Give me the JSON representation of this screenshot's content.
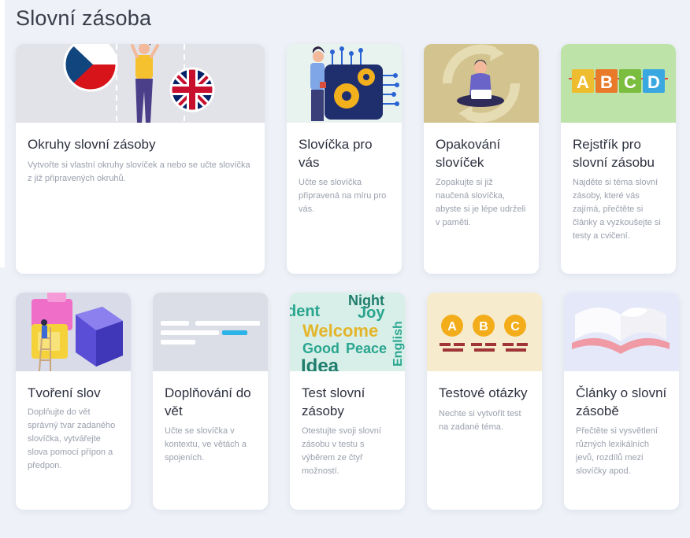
{
  "page": {
    "title": "Slovní zásoba"
  },
  "cards": [
    {
      "title": "Okruhy slovní zásoby",
      "description": "Vytvořte si vlastní okruhy slovíček a nebo se učte slovíčka z již připravených okruhů.",
      "image": "czech-english-flags-illustration"
    },
    {
      "title": "Slovíčka pro vás",
      "description": "Učte se slovíčka připravená na míru pro vás.",
      "image": "person-with-gears-illustration"
    },
    {
      "title": "Opakování slovíček",
      "description": "Zopakujte si již naučená slovíčka, abyste si je lépe udrželi v paměti.",
      "image": "person-with-laptop-illustration"
    },
    {
      "title": "Rejstřík pro slovní zásobu",
      "description": "Najděte si téma slovní zásoby, které vás zajímá, přečtěte si články a vyzkoušejte si testy a cvičení.",
      "image": "abcd-blocks-illustration",
      "letters": [
        "A",
        "B",
        "C",
        "D"
      ]
    },
    {
      "title": "Tvoření slov",
      "description": "Doplňujte do vět správný tvar zadaného slovíčka, vytvářejte slova pomocí přípon a předpon.",
      "image": "puzzle-blocks-illustration"
    },
    {
      "title": "Doplňování do vět",
      "description": "Učte se slovíčka v kontextu, ve větách a spojeních.",
      "image": "text-lines-illustration"
    },
    {
      "title": "Test slovní zásoby",
      "description": "Otestujte svoji slovní zásobu v testu s výběrem ze čtyř možností.",
      "image": "word-cloud-illustration",
      "words": [
        "Welcome",
        "Good",
        "Peace",
        "Idea",
        "Joy",
        "dent",
        "Night",
        "English"
      ]
    },
    {
      "title": "Testové otázky",
      "description": "Nechte si vytvořit test na zadané téma.",
      "image": "abc-answers-illustration",
      "letters": [
        "A",
        "B",
        "C"
      ]
    },
    {
      "title": "Články o slovní zásobě",
      "description": "Přečtěte si vysvětlení různých lexikálních jevů, rozdílů mezi slovíčky apod.",
      "image": "open-book-illustration"
    }
  ]
}
